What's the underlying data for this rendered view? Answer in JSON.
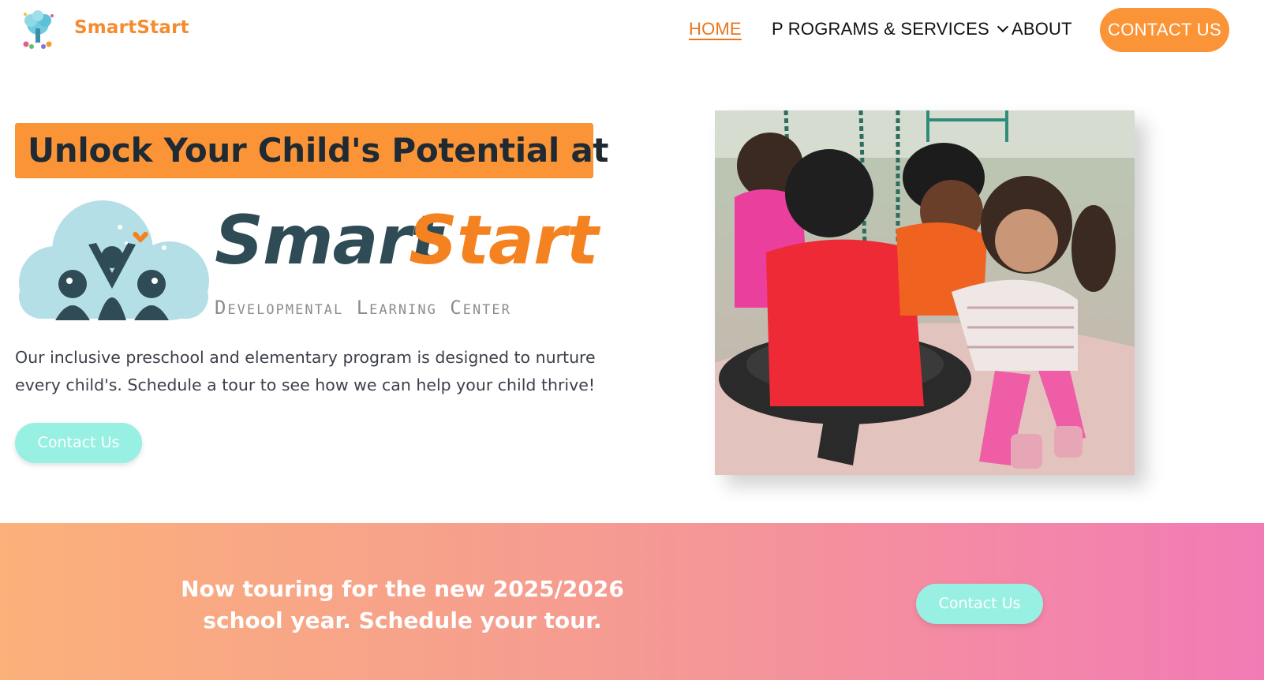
{
  "header": {
    "brand_name": "SmartStart",
    "nav": {
      "home": "Home",
      "programs": "P rograms & Services",
      "about": "About"
    },
    "contact_button": "Contact Us"
  },
  "hero": {
    "title": "Unlock Your Child's Potential at",
    "logo": {
      "word1": "Smart",
      "word2": "Start",
      "subtitle": "Developmental Learning Center"
    },
    "description": "Our inclusive preschool and elementary program is designed to nurture every child's. Schedule a tour to see how we can help your child thrive!",
    "contact_button": "Contact Us",
    "photo_alt": "Children playing on a tire swing"
  },
  "banner": {
    "text_line1": "Now touring for the new 2025/2026",
    "text_line2": "school year. Schedule your tour.",
    "contact_button": "Contact Us"
  },
  "icons": {
    "brand_logo": "tree-children-icon",
    "logo_mark": "cloud-children-icon",
    "dropdown": "chevron-down-icon"
  },
  "colors": {
    "accent_orange": "#fb9436",
    "brand_orange": "#f58b2f",
    "mint": "#98f0e3",
    "dark_teal": "#2f4b55",
    "light_blue": "#b5dfe6",
    "banner_start": "#fbb17a",
    "banner_end": "#f27bb5"
  }
}
